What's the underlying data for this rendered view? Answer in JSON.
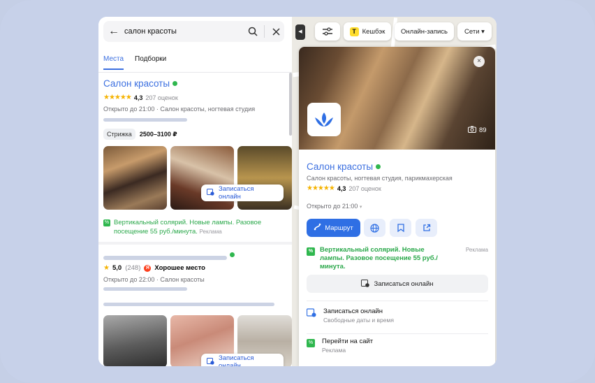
{
  "search": {
    "query": "салон красоты"
  },
  "tabs": [
    {
      "label": "Места"
    },
    {
      "label": "Подборки"
    }
  ],
  "result1": {
    "title": "Салон красоты",
    "rating": "4,3",
    "reviews": "207 оценок",
    "hours": "Открыто до 21:00 · Салон красоты, ногтевая студия",
    "service_chip": "Стрижка",
    "price": "2500–3100 ₽",
    "book_label": "Записаться онлайн",
    "promo": "Вертикальный солярий. Новые лампы. Разовое посещение 55 руб./минута.",
    "promo_ad": "Реклама"
  },
  "result2": {
    "rating": "5,0",
    "reviews": "(248)",
    "badge": "Хорошее место",
    "hours": "Открыто до 22:00 · Салон красоты",
    "book_label": "Записаться онлайн"
  },
  "map": {
    "filters_label": "",
    "cashback": "Кешбэк",
    "online": "Онлайн-запись",
    "chains": "Сети ▾"
  },
  "place": {
    "photo_count": "89",
    "title": "Салон красоты",
    "subtitle": "Салон красоты, ногтевая студия, парикмахерская",
    "rating": "4,3",
    "reviews": "207 оценок",
    "hours": "Открыто до 21:00",
    "route_label": "Маршрут",
    "promo": "Вертикальный солярий. Новые лампы. Разовое посещение 55 руб./минута.",
    "promo_ad": "Реклама",
    "book_label": "Записаться онлайн",
    "item1_title": "Записаться онлайн",
    "item1_sub": "Свободные даты и время",
    "item2_title": "Перейти на сайт",
    "item2_sub": "Реклама"
  },
  "colors": {
    "accent": "#3b6fe0",
    "promo": "#2aa84a",
    "frame": "#c7d1e9"
  }
}
